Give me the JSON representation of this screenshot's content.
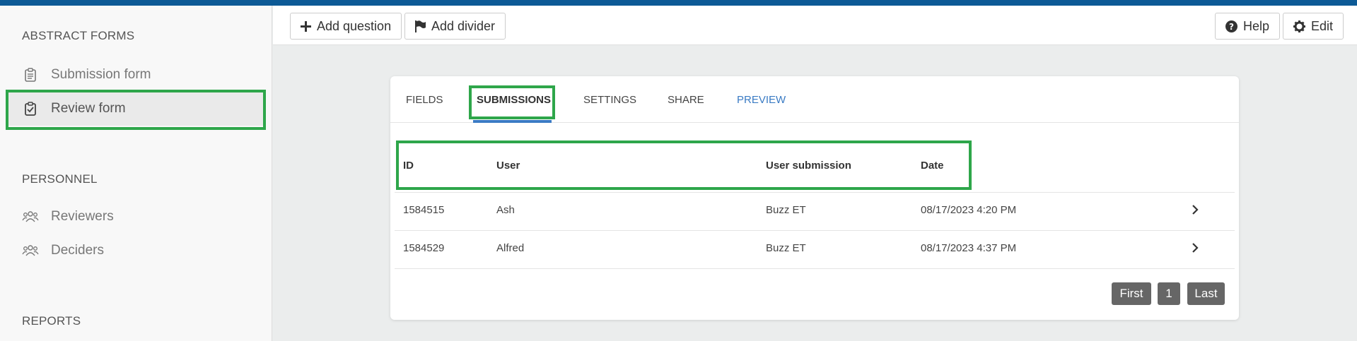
{
  "sidebar": {
    "sections": [
      {
        "title": "ABSTRACT FORMS"
      },
      {
        "title": "PERSONNEL"
      },
      {
        "title": "REPORTS"
      }
    ],
    "items": [
      {
        "label": "Submission form",
        "icon": "clipboard-list-icon"
      },
      {
        "label": "Review form",
        "icon": "clipboard-check-icon"
      },
      {
        "label": "Reviewers",
        "icon": "users-icon"
      },
      {
        "label": "Deciders",
        "icon": "users-icon"
      }
    ]
  },
  "toolbar": {
    "add_question_label": "Add question",
    "add_divider_label": "Add divider",
    "help_label": "Help",
    "edit_label": "Edit"
  },
  "tabs": [
    {
      "label": "FIELDS"
    },
    {
      "label": "SUBMISSIONS"
    },
    {
      "label": "SETTINGS"
    },
    {
      "label": "SHARE"
    },
    {
      "label": "PREVIEW"
    }
  ],
  "table": {
    "headers": [
      "ID",
      "User",
      "User submission",
      "Date"
    ],
    "rows": [
      {
        "id": "1584515",
        "user": "Ash",
        "submission": "Buzz ET",
        "date": "08/17/2023 4:20 PM"
      },
      {
        "id": "1584529",
        "user": "Alfred",
        "submission": "Buzz ET",
        "date": "08/17/2023 4:37 PM"
      }
    ]
  },
  "pagination": {
    "first": "First",
    "page": "1",
    "last": "Last"
  },
  "colors": {
    "accent": "#3a7bc4",
    "topbar": "#0d5a96",
    "highlight": "#2ea64a",
    "pager": "#666666"
  }
}
